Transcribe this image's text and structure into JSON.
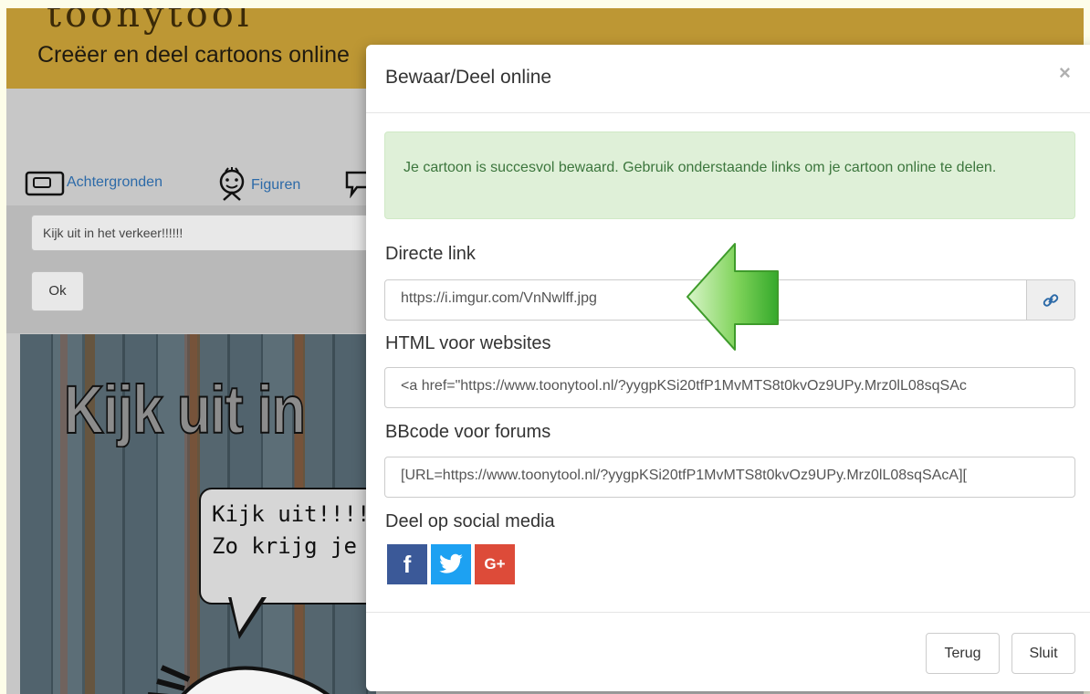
{
  "app": {
    "logo_text": "toonytool",
    "tagline": "Creëer en deel cartoons online"
  },
  "toolbar": {
    "items": [
      {
        "label": "Achtergronden",
        "icon": "background-icon"
      },
      {
        "label": "Figuren",
        "icon": "figure-icon"
      },
      {
        "label": "",
        "icon": "speech-bubble-icon"
      }
    ]
  },
  "editor": {
    "text_value": "Kijk uit in het verkeer!!!!!!",
    "ok_label": "Ok"
  },
  "cartoon": {
    "big_text": "Kijk uit in",
    "bubble_text": "Kijk uit!!!!!\nZo krijg je"
  },
  "modal": {
    "title": "Bewaar/Deel online",
    "close_symbol": "×",
    "success_message": "Je cartoon is succesvol bewaard. Gebruik onderstaande links om je cartoon online te delen.",
    "direct_link": {
      "label": "Directe link",
      "value": "https://i.imgur.com/VnNwlff.jpg",
      "button_icon": "link-icon"
    },
    "html_code": {
      "label": "HTML voor websites",
      "value": "<a href=\"https://www.toonytool.nl/?yygpKSi20tfP1MvMTS8t0kvOz9UPy.Mrz0lL08sqSAc"
    },
    "bbcode": {
      "label": "BBcode voor forums",
      "value": "[URL=https://www.toonytool.nl/?yygpKSi20tfP1MvMTS8t0kvOz9UPy.Mrz0lL08sqSAcA]["
    },
    "social": {
      "label": "Deel op social media",
      "buttons": [
        {
          "name": "facebook",
          "glyph": "f",
          "color": "#3b5998"
        },
        {
          "name": "twitter",
          "glyph": "",
          "color": "#1da1f2"
        },
        {
          "name": "google-plus",
          "glyph": "G+",
          "color": "#dd4b39"
        }
      ]
    },
    "footer": {
      "back_label": "Terug",
      "close_label": "Sluit"
    }
  },
  "colors": {
    "header": "#bd9734",
    "alert_bg": "#dff0d8",
    "alert_text": "#3c763d",
    "arrow_green": "#5fc23a",
    "link": "#2c6aa8"
  }
}
